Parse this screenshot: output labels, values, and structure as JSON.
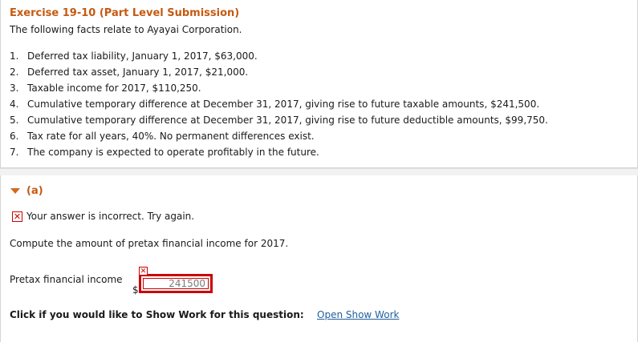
{
  "exercise": {
    "title": "Exercise 19-10 (Part Level Submission)",
    "intro": "The following facts relate to Ayayai Corporation."
  },
  "facts": [
    {
      "num": "1.",
      "text": "Deferred tax liability, January 1, 2017, $63,000."
    },
    {
      "num": "2.",
      "text": "Deferred tax asset, January 1, 2017, $21,000."
    },
    {
      "num": "3.",
      "text": "Taxable income for 2017, $110,250."
    },
    {
      "num": "4.",
      "text": "Cumulative temporary difference at December 31, 2017, giving rise to future taxable amounts, $241,500."
    },
    {
      "num": "5.",
      "text": "Cumulative temporary difference at December 31, 2017, giving rise to future deductible amounts, $99,750."
    },
    {
      "num": "6.",
      "text": "Tax rate for all years, 40%. No permanent differences exist."
    },
    {
      "num": "7.",
      "text": "The company is expected to operate profitably in the future."
    }
  ],
  "part": {
    "label": "(a)",
    "feedback": "Your answer is incorrect.  Try again.",
    "question": "Compute the amount of pretax financial income for 2017.",
    "field_label": "Pretax financial income",
    "currency": "$",
    "answer_value": "241500",
    "show_work_prompt": "Click if you would like to Show Work for this question:",
    "show_work_link": "Open Show Work"
  },
  "colors": {
    "accent": "#c55a11",
    "error": "#cc0000",
    "link": "#1f5f9f"
  }
}
